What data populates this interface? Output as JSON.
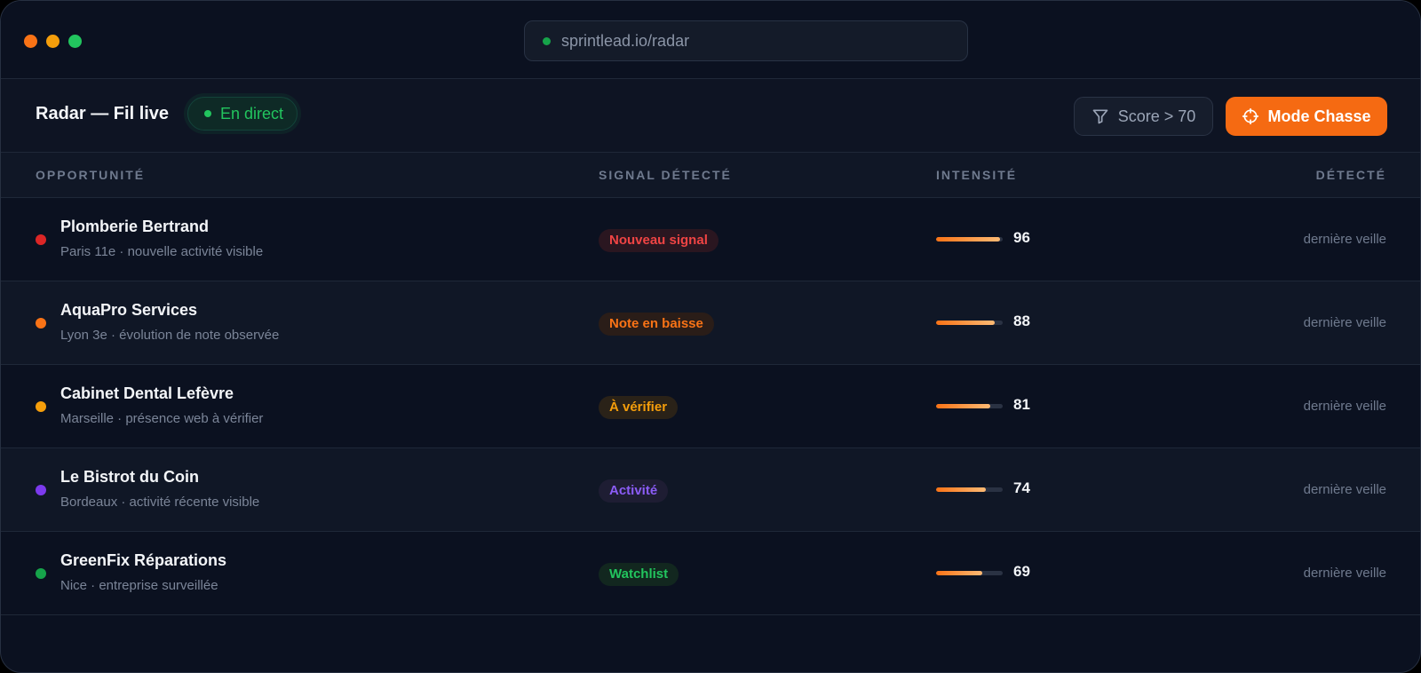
{
  "browser": {
    "traffic_colors": [
      "#f97316",
      "#f59e0b",
      "#22c55e"
    ],
    "url": "sprintlead.io/radar",
    "url_status_color": "#16a34a"
  },
  "toolbar": {
    "title": "Radar — Fil live",
    "live_badge": "En direct",
    "filter_label": "Score > 70",
    "filter_icon": "funnel-icon",
    "hunt_label": "Mode Chasse",
    "hunt_icon": "crosshair-icon",
    "accent_color": "#f56a12"
  },
  "table": {
    "columns": [
      "OPPORTUNITÉ",
      "SIGNAL DÉTECTÉ",
      "INTENSITÉ",
      "DÉTECTÉ"
    ],
    "rows": [
      {
        "name": "Plomberie Bertrand",
        "subtitle": "Paris 11e · nouvelle activité visible",
        "dot_color": "#dc2626",
        "signal": "Nouveau signal",
        "signal_color": "#ef4444",
        "signal_bg": "#2a1620",
        "intensity": 96,
        "detected": "dernière veille"
      },
      {
        "name": "AquaPro Services",
        "subtitle": "Lyon 3e · évolution de note observée",
        "dot_color": "#f97316",
        "signal": "Note en baisse",
        "signal_color": "#f97316",
        "signal_bg": "#2a1d18",
        "intensity": 88,
        "detected": "dernière veille"
      },
      {
        "name": "Cabinet Dental Lefèvre",
        "subtitle": "Marseille · présence web à vérifier",
        "dot_color": "#f59e0b",
        "signal": "À vérifier",
        "signal_color": "#f59e0b",
        "signal_bg": "#2a2218",
        "intensity": 81,
        "detected": "dernière veille"
      },
      {
        "name": "Le Bistrot du Coin",
        "subtitle": "Bordeaux · activité récente visible",
        "dot_color": "#7c3aed",
        "signal": "Activité",
        "signal_color": "#8b5cf6",
        "signal_bg": "#1e1d33",
        "intensity": 74,
        "detected": "dernière veille"
      },
      {
        "name": "GreenFix Réparations",
        "subtitle": "Nice · entreprise surveillée",
        "dot_color": "#16a34a",
        "signal": "Watchlist",
        "signal_color": "#22c55e",
        "signal_bg": "#12271f",
        "intensity": 69,
        "detected": "dernière veille"
      }
    ]
  }
}
